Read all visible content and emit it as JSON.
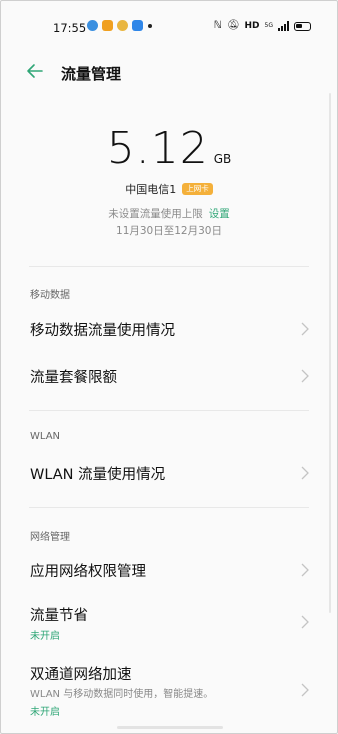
{
  "status_bar": {
    "time": "17:55",
    "hd_label": "HD",
    "network_label": "5G",
    "icons": [
      "nfc-icon",
      "mute-icon",
      "hd-icon",
      "signal-icon",
      "battery-icon"
    ]
  },
  "header": {
    "title": "流量管理",
    "back_icon": "back-arrow-icon"
  },
  "usage": {
    "value": "5.12",
    "unit": "GB",
    "carrier": "中国电信1",
    "sim_badge": "上网卡",
    "limit_text": "未设置流量使用上限",
    "set_label": "设置",
    "period": "11月30日至12月30日"
  },
  "sections": {
    "mobile": {
      "label": "移动数据",
      "items": [
        {
          "title": "移动数据流量使用情况"
        },
        {
          "title": "流量套餐限额"
        }
      ]
    },
    "wlan": {
      "label": "WLAN",
      "items": [
        {
          "title": "WLAN 流量使用情况"
        }
      ]
    },
    "network": {
      "label": "网络管理",
      "items": [
        {
          "title": "应用网络权限管理"
        },
        {
          "title": "流量节省",
          "status": "未开启"
        },
        {
          "title": "双通道网络加速",
          "subtitle": "WLAN 与移动数据同时使用，智能提速。",
          "status": "未开启"
        }
      ]
    }
  },
  "colors": {
    "accent": "#2fa676",
    "badge": "#f4b03a"
  }
}
